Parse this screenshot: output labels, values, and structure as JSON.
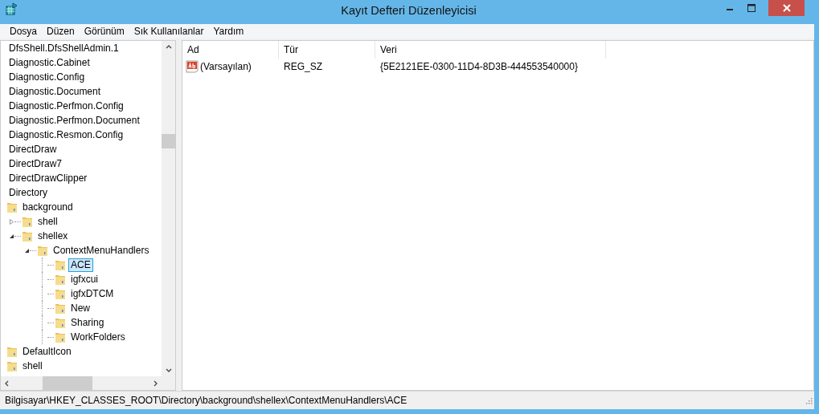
{
  "window": {
    "title": "Kayıt Defteri Düzenleyicisi"
  },
  "menu": [
    "Dosya",
    "Düzen",
    "Görünüm",
    "Sık Kullanılanlar",
    "Yardım"
  ],
  "tree": [
    {
      "label": "DfsShell.DfsShellAdmin.1",
      "selected": false
    },
    {
      "label": "Diagnostic.Cabinet",
      "selected": false
    },
    {
      "label": "Diagnostic.Config",
      "selected": false
    },
    {
      "label": "Diagnostic.Document",
      "selected": false
    },
    {
      "label": "Diagnostic.Perfmon.Config",
      "selected": false
    },
    {
      "label": "Diagnostic.Perfmon.Document",
      "selected": false
    },
    {
      "label": "Diagnostic.Resmon.Config",
      "selected": false
    },
    {
      "label": "DirectDraw",
      "selected": false
    },
    {
      "label": "DirectDraw7",
      "selected": false
    },
    {
      "label": "DirectDrawClipper",
      "selected": false
    },
    {
      "label": "Directory",
      "selected": false,
      "children": [
        {
          "label": "background",
          "selected": false,
          "children": [
            {
              "label": "shell",
              "selected": false,
              "expanded": false
            },
            {
              "label": "shellex",
              "selected": false,
              "expanded": true,
              "children": [
                {
                  "label": "ContextMenuHandlers",
                  "selected": false,
                  "expanded": true,
                  "children": [
                    {
                      "label": "ACE",
                      "selected": true
                    },
                    {
                      "label": "igfxcui",
                      "selected": false
                    },
                    {
                      "label": "igfxDTCM",
                      "selected": false
                    },
                    {
                      "label": "New",
                      "selected": false
                    },
                    {
                      "label": "Sharing",
                      "selected": false
                    },
                    {
                      "label": "WorkFolders",
                      "selected": false
                    }
                  ]
                }
              ]
            }
          ]
        },
        {
          "label": "DefaultIcon",
          "selected": false
        },
        {
          "label": "shell",
          "selected": false
        }
      ]
    }
  ],
  "table": {
    "columns": [
      "Ad",
      "Tür",
      "Veri"
    ],
    "rows": [
      {
        "name": "(Varsayılan)",
        "type": "REG_SZ",
        "data": "{5E2121EE-0300-11D4-8D3B-444553540000}"
      }
    ]
  },
  "status_bar": "Bilgisayar\\HKEY_CLASSES_ROOT\\Directory\\background\\shellex\\ContextMenuHandlers\\ACE"
}
